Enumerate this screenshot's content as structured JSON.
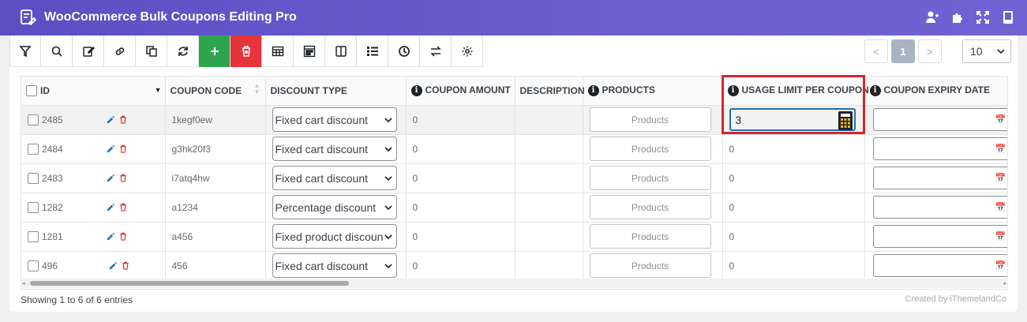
{
  "app": {
    "title": "WooCommerce Bulk Coupons Editing Pro"
  },
  "header_icons": [
    "user-add-icon",
    "puzzle-icon",
    "fullscreen-icon",
    "book-icon"
  ],
  "toolbar": {
    "buttons": [
      "filter-icon",
      "search-icon",
      "edit-icon",
      "link-icon",
      "duplicate-icon",
      "refresh-icon",
      "add-icon",
      "delete-icon",
      "table-icon",
      "columns-icon",
      "split-icon",
      "list-icon",
      "history-icon",
      "sync-icon",
      "settings-icon"
    ],
    "add_color": "#2ea44f",
    "delete_color": "#e5343c"
  },
  "pagination": {
    "prev": "<",
    "current": "1",
    "next": ">",
    "per_page": "10"
  },
  "table": {
    "headers": {
      "id": "ID",
      "coupon_code": "COUPON CODE",
      "discount_type": "DISCOUNT TYPE",
      "coupon_amount": "COUPON AMOUNT",
      "description": "DESCRIPTION",
      "products": "PRODUCTS",
      "usage_limit": "USAGE LIMIT PER COUPON",
      "expiry": "COUPON EXPIRY DATE"
    },
    "products_label": "Products",
    "rows": [
      {
        "id": "2485",
        "code": "1kegf0ew",
        "type": "Fixed cart discount",
        "amount": "0",
        "usage": "3"
      },
      {
        "id": "2484",
        "code": "g3hk20f3",
        "type": "Fixed cart discount",
        "amount": "0",
        "usage": "0"
      },
      {
        "id": "2483",
        "code": "i7atq4hw",
        "type": "Fixed cart discount",
        "amount": "0",
        "usage": "0"
      },
      {
        "id": "1282",
        "code": "a1234",
        "type": "Percentage discount",
        "amount": "0",
        "usage": "0"
      },
      {
        "id": "1281",
        "code": "a456",
        "type": "Fixed product discount",
        "amount": "0",
        "usage": "0"
      },
      {
        "id": "496",
        "code": "456",
        "type": "Fixed cart discount",
        "amount": "0",
        "usage": "0"
      }
    ]
  },
  "footer": {
    "showing": "Showing 1 to 6 of 6 entries",
    "created_by": "Created by iThemelandCo"
  },
  "colors": {
    "header_bg": "#5b4fc4",
    "highlight": "#d6262d",
    "edit_icon": "#2271b1",
    "delete_icon": "#d63638"
  }
}
